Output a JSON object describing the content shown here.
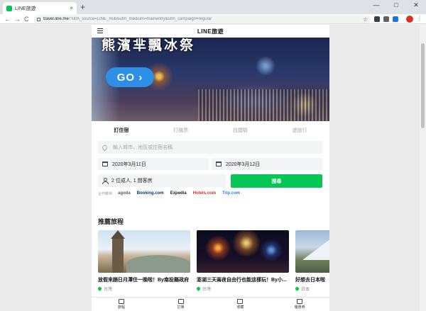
{
  "browser": {
    "tab_title": "LINE旅遊",
    "tab_close": "×",
    "new_tab": "+",
    "url_host": "travel.line.me",
    "url_rest": "/?utm_source=LINE_Hub&utm_medium=mainentry&utm_campaign=regular",
    "back": "←",
    "forward": "→",
    "reload": "C",
    "bookmark": "☆",
    "menu": "⋮",
    "minimize": "—",
    "maximize": "□",
    "close": "✕"
  },
  "header": {
    "logo": "LINE旅遊"
  },
  "banner": {
    "headline": "熊濱芈飄冰祭",
    "go_label": "GO ›"
  },
  "booking_tabs": [
    {
      "label": "訂住宿",
      "active": true
    },
    {
      "label": "訂機票",
      "active": false
    },
    {
      "label": "找體驗",
      "active": false
    },
    {
      "label": "遊旅行",
      "active": false
    }
  ],
  "search": {
    "placeholder": "輸入城市、地區或住宿名稱",
    "checkin": "2020年3月11日",
    "checkout": "2020年3月12日",
    "guests": "2 位成人, 1 間客房",
    "button": "搜尋"
  },
  "partners": {
    "label": "合作夥伴",
    "items": [
      {
        "name": "agoda",
        "color": "#5e5e5e"
      },
      {
        "name": "Booking.com",
        "color": "#003580"
      },
      {
        "name": "Expedia",
        "color": "#1a1a1a"
      },
      {
        "name": "Hotels.com",
        "color": "#d32f2f"
      },
      {
        "name": "Trip.com",
        "color": "#287dfa"
      }
    ]
  },
  "recommend": {
    "title": "推薦旅程",
    "cards": [
      {
        "title": "放假來趟日月潭住一晚啦！By南投縣政府",
        "location": "台灣"
      },
      {
        "title": "澎湖三天兩夜自由行也能這樣玩！By小...",
        "location": "台灣"
      },
      {
        "title": "好想去日本啦",
        "location": "日本"
      }
    ]
  },
  "bottom_nav": [
    {
      "label": "旅程"
    },
    {
      "label": "訂單"
    },
    {
      "label": "收藏"
    },
    {
      "label": "優惠券"
    }
  ],
  "colors": {
    "brand_green": "#06c755",
    "go_blue": "#2d8fe6"
  }
}
